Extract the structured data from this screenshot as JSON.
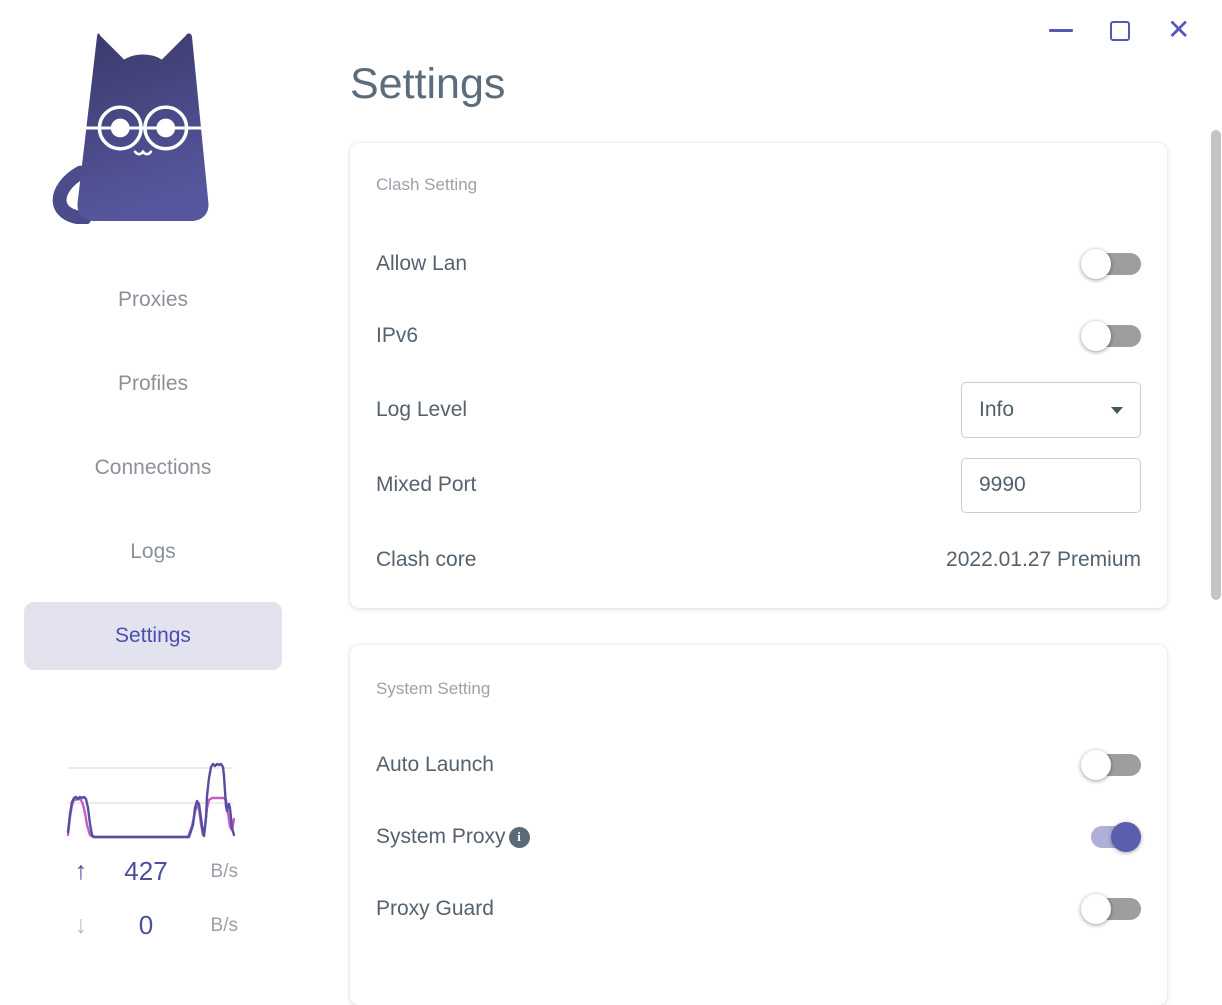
{
  "window": {
    "close_glyph": "✕"
  },
  "sidebar": {
    "nav": [
      {
        "label": "Proxies",
        "active": false
      },
      {
        "label": "Profiles",
        "active": false
      },
      {
        "label": "Connections",
        "active": false
      },
      {
        "label": "Logs",
        "active": false
      },
      {
        "label": "Settings",
        "active": true
      }
    ],
    "traffic": {
      "up_glyph": "↑",
      "up_value": "427",
      "up_unit": "B/s",
      "down_glyph": "↓",
      "down_value": "0",
      "down_unit": "B/s"
    }
  },
  "page": {
    "title": "Settings"
  },
  "cards": [
    {
      "section": "Clash Setting",
      "rows": [
        {
          "label": "Allow Lan",
          "control": "toggle",
          "state": "off"
        },
        {
          "label": "IPv6",
          "control": "toggle",
          "state": "off"
        },
        {
          "label": "Log Level",
          "control": "select",
          "value": "Info"
        },
        {
          "label": "Mixed Port",
          "control": "input",
          "value": "9990"
        },
        {
          "label": "Clash core",
          "control": "text",
          "value": "2022.01.27 Premium"
        }
      ]
    },
    {
      "section": "System Setting",
      "rows": [
        {
          "label": "Auto Launch",
          "control": "toggle",
          "state": "off"
        },
        {
          "label": "System Proxy",
          "control": "toggle",
          "state": "on",
          "info_glyph": "i"
        },
        {
          "label": "Proxy Guard",
          "control": "toggle",
          "state": "off"
        }
      ]
    }
  ],
  "colors": {
    "accent": "#5457b7",
    "active_nav_bg": "#e3e3f0",
    "active_nav_text": "#4a50a9",
    "toggle_on_track": "#aeb0d9",
    "toggle_on_thumb": "#5a5fad",
    "toggle_off_track": "#9d9d9d",
    "graph_upload_line": "#544fa0",
    "graph_download_line": "#c35fc2"
  }
}
